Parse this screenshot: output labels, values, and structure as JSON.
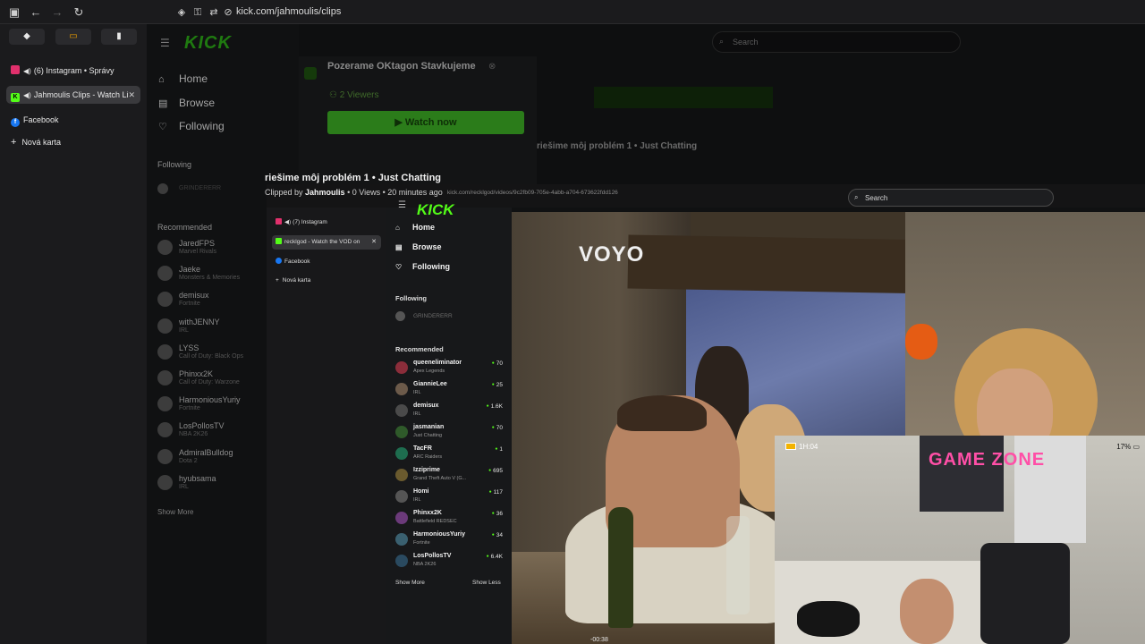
{
  "browser": {
    "url": "kick.com/jahmoulis/clips",
    "tabs": [
      {
        "label": "(6) Instagram • Správy",
        "icon_color": "#e1306c"
      },
      {
        "label": "Jahmoulis Clips - Watch Li",
        "icon_color": "#53fc18",
        "active": true
      },
      {
        "label": "Facebook",
        "icon_color": "#1877f2"
      },
      {
        "label": "Nová karta",
        "icon_color": ""
      }
    ]
  },
  "kick": {
    "logo": "KICK",
    "search_placeholder": "Search",
    "nav": [
      {
        "label": "Home",
        "icon": "home-icon"
      },
      {
        "label": "Browse",
        "icon": "browse-icon"
      },
      {
        "label": "Following",
        "icon": "heart-icon"
      }
    ],
    "following_label": "Following",
    "following_item": "GRINDERERR",
    "recommended_label": "Recommended",
    "recommended": [
      {
        "name": "JaredFPS",
        "game": "Marvel Rivals"
      },
      {
        "name": "Jaeke",
        "game": "Monsters & Memories"
      },
      {
        "name": "demisux",
        "game": "Fortnite"
      },
      {
        "name": "withJENNY",
        "game": "IRL"
      },
      {
        "name": "LYSS",
        "game": "Call of Duty: Black Ops"
      },
      {
        "name": "Phinxx2K",
        "game": "Call of Duty: Warzone"
      },
      {
        "name": "HarmoniousYuriy",
        "game": "Fortnite"
      },
      {
        "name": "LosPollosTV",
        "game": "NBA 2K26"
      },
      {
        "name": "AdmiralBulldog",
        "game": "Dota 2"
      },
      {
        "name": "hyubsama",
        "game": "IRL"
      }
    ],
    "show_more": "Show More",
    "live_card": {
      "title": "Pozerame OKtagon Stavkujeme",
      "viewers": "2 Viewers",
      "watch": "Watch now"
    }
  },
  "clip": {
    "title": "riešime môj problém 1 • Just Chatting",
    "clipped_by_prefix": "Clipped by",
    "clipper": "Jahmoulis",
    "meta": "• 0 Views • 20 minutes ago",
    "ghost_title": "riešime môj problém 1 • Just Chatting"
  },
  "embed": {
    "url": "kick.com/recklgod/videos/9c2fb09-705e-4abb-a704-673622fdd126",
    "tabs": [
      {
        "label": "(7) Instagram",
        "icon_color": "#e1306c"
      },
      {
        "label": "recklgod - Watch the VOD on",
        "icon_color": "#53fc18",
        "active": true
      },
      {
        "label": "Facebook",
        "icon_color": "#1877f2"
      },
      {
        "label": "Nová karta",
        "icon_color": ""
      }
    ],
    "following_item": "GRINDERERR",
    "recommended": [
      {
        "name": "queeneliminator",
        "game": "Apex Legends",
        "viewers": "70"
      },
      {
        "name": "GiannieLee",
        "game": "IRL",
        "viewers": "25"
      },
      {
        "name": "demisux",
        "game": "IRL",
        "viewers": "1.6K"
      },
      {
        "name": "jasmanian",
        "game": "Just Chatting",
        "viewers": "70"
      },
      {
        "name": "TacFR",
        "game": "ARC Raiders",
        "viewers": "1"
      },
      {
        "name": "Izziprime",
        "game": "Grand Theft Auto V (G...",
        "viewers": "695"
      },
      {
        "name": "Homi",
        "game": "IRL",
        "viewers": "117"
      },
      {
        "name": "Phinxx2K",
        "game": "Battlefield REDSEC",
        "viewers": "36"
      },
      {
        "name": "HarmoniousYuriy",
        "game": "Fortnite",
        "viewers": "34"
      },
      {
        "name": "LosPollosTV",
        "game": "NBA 2K26",
        "viewers": "6.4K"
      }
    ],
    "show_more": "Show More",
    "show_less": "Show Less",
    "video": {
      "watermark": "VOYO",
      "timecode": "-00:38"
    },
    "cam": {
      "battery_time": "1H:04",
      "sign": "GAME ZONE",
      "percent": "17%"
    }
  }
}
